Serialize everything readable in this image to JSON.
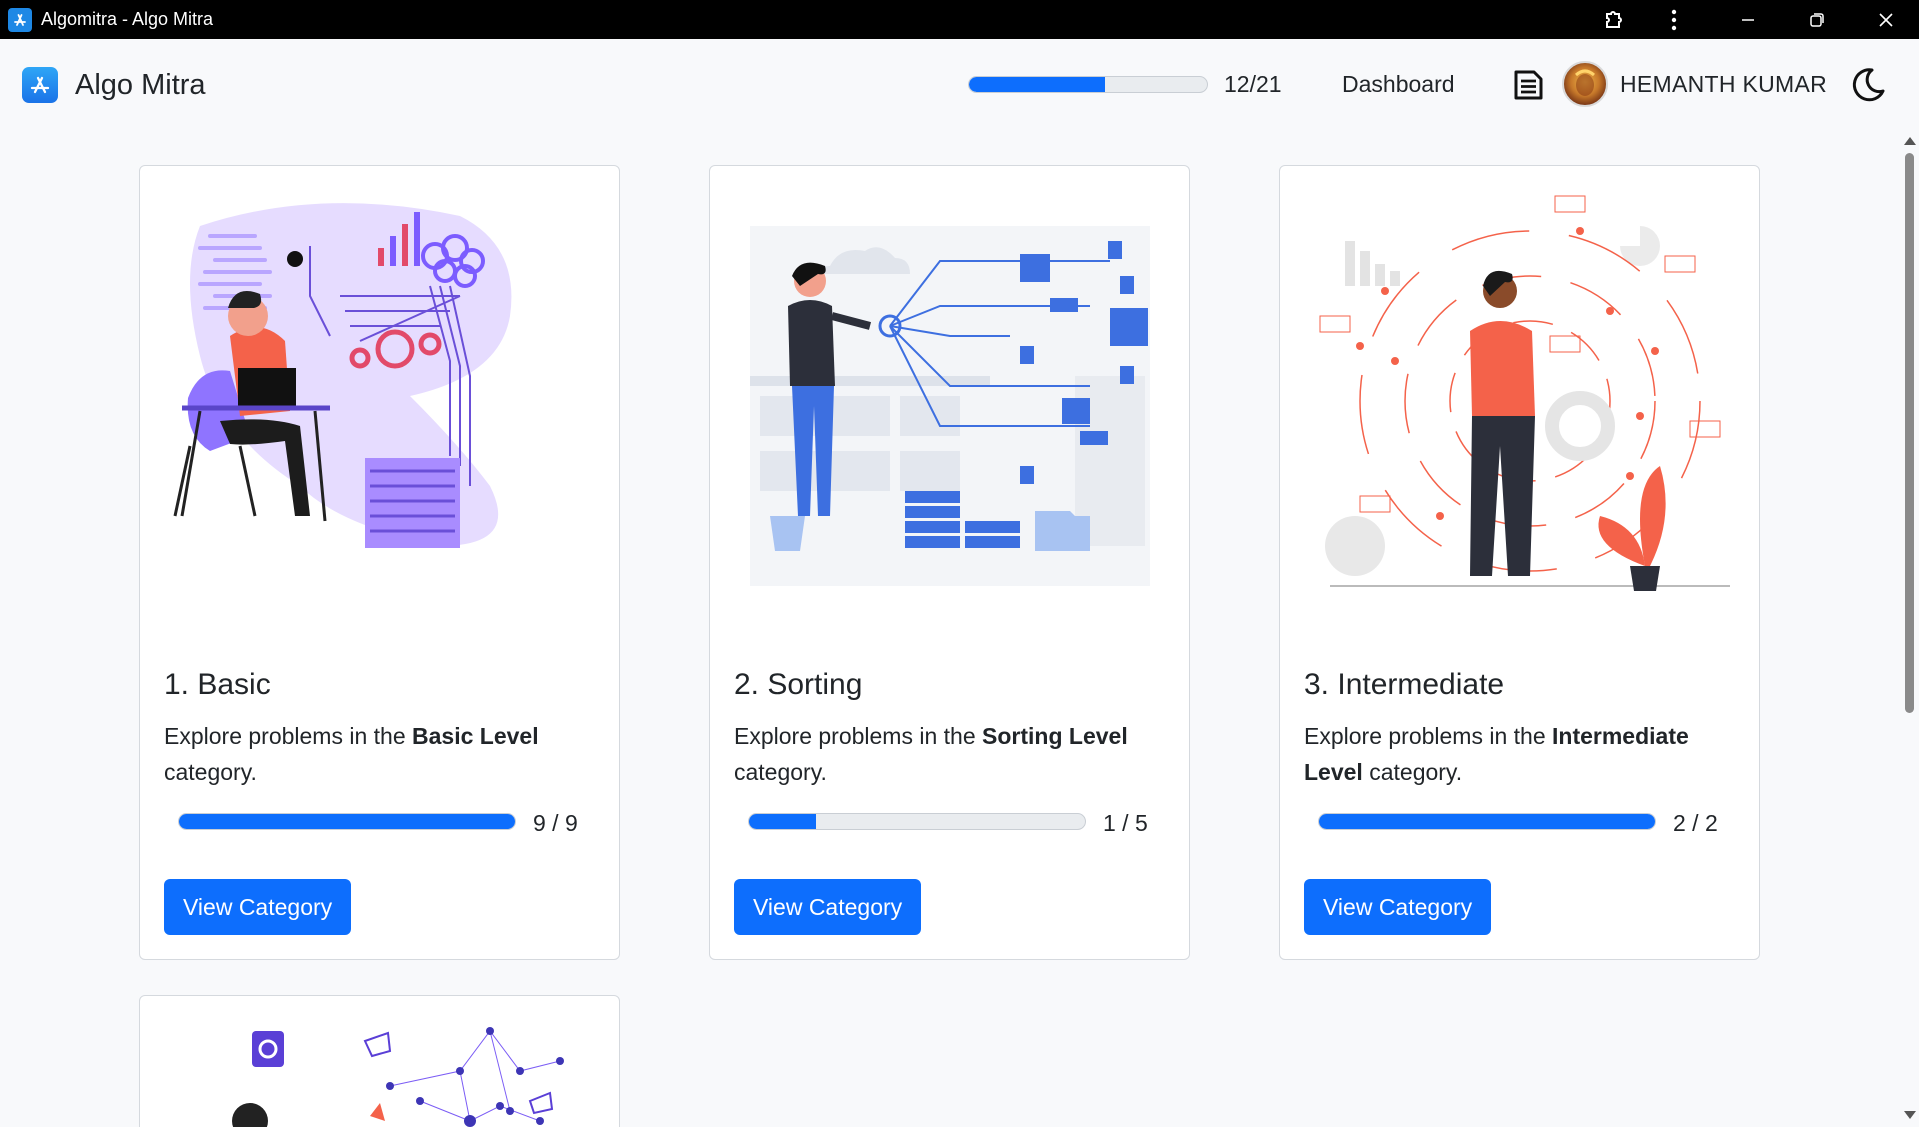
{
  "window": {
    "title": "Algomitra - Algo Mitra",
    "controls": [
      "extensions-icon",
      "more-icon",
      "minimize-icon",
      "restore-icon",
      "close-icon"
    ]
  },
  "navbar": {
    "brand": "Algo Mitra",
    "overall_progress": {
      "label": "12/21",
      "solved": 12,
      "total": 21
    },
    "dashboard_label": "Dashboard",
    "user_name": "HEMANTH KUMAR",
    "icons": [
      "app-store-icon",
      "notes-icon",
      "avatar",
      "moon-icon"
    ]
  },
  "categories": [
    {
      "title": "1. Basic",
      "desc_prefix": "Explore problems in the ",
      "desc_bold": "Basic Level",
      "desc_suffix": " category.",
      "progress": {
        "label": "9 / 9",
        "solved": 9,
        "total": 9
      },
      "button": "View Category"
    },
    {
      "title": "2. Sorting",
      "desc_prefix": "Explore problems in the ",
      "desc_bold": "Sorting Level",
      "desc_suffix": " category.",
      "progress": {
        "label": "1 / 5",
        "solved": 1,
        "total": 5
      },
      "button": "View Category"
    },
    {
      "title": "3. Intermediate",
      "desc_prefix": "Explore problems in the ",
      "desc_bold": "Intermediate Level",
      "desc_suffix": " category.",
      "progress": {
        "label": "2 / 2",
        "solved": 2,
        "total": 2
      },
      "button": "View Category"
    }
  ],
  "colors": {
    "primary": "#0d6efd",
    "accent_purple": "#7c5cff",
    "accent_blue": "#3d6fe0",
    "accent_coral": "#f4624a",
    "background": "#f8f9fb"
  }
}
